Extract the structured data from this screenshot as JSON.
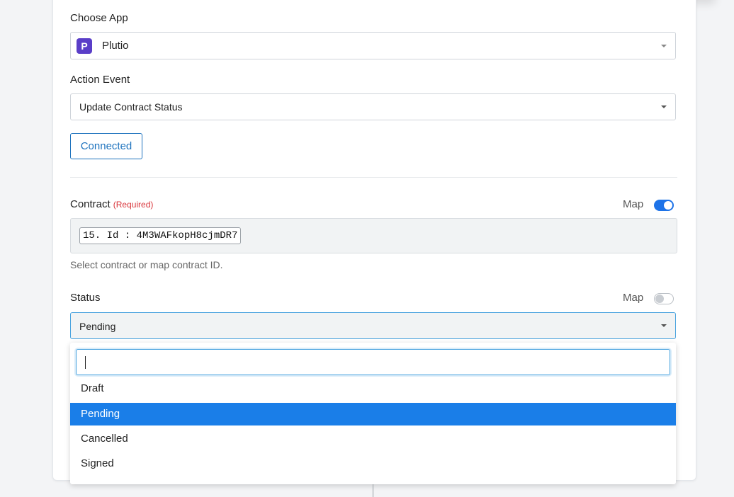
{
  "app_section": {
    "label": "Choose App",
    "selected_app": "Plutio",
    "app_icon_letter": "P",
    "app_icon_color": "#5a3ec8"
  },
  "action_section": {
    "label": "Action Event",
    "selected_event": "Update Contract Status"
  },
  "connection": {
    "button_label": "Connected"
  },
  "contract_field": {
    "label": "Contract",
    "required_text": "(Required)",
    "map_label": "Map",
    "map_enabled": true,
    "mapped_value": "15. Id : 4M3WAFkopH8cjmDR7",
    "helper_text": "Select contract or map contract ID."
  },
  "status_field": {
    "label": "Status",
    "map_label": "Map",
    "map_enabled": false,
    "selected_value": "Pending",
    "search_value": "",
    "options": [
      "Draft",
      "Pending",
      "Cancelled",
      "Signed"
    ],
    "selected_index": 1
  },
  "colors": {
    "accent": "#1e73be",
    "selected_option": "#1a7ee8",
    "required": "#d9343a"
  }
}
